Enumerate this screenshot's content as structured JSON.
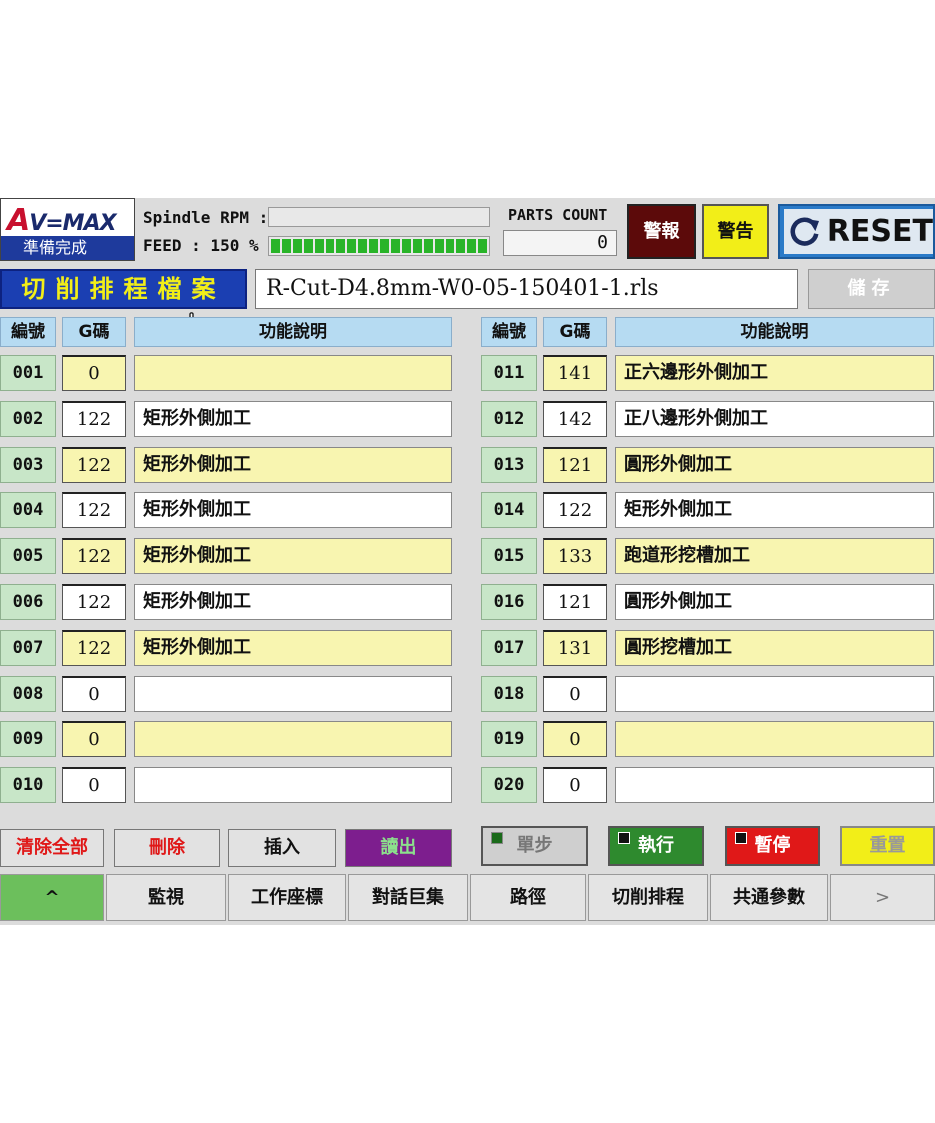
{
  "header": {
    "logo_text": "AVEMAX",
    "status": "準備完成",
    "spindle_label": "Spindle RPM :",
    "feed_label": "FEED :  150 %",
    "feed_level": 1.0,
    "parts_count_label": "PARTS COUNT",
    "parts_count_value": "0",
    "alarm_label": "警報",
    "warning_label": "警告",
    "reset_label": "RESET"
  },
  "program": {
    "title": "切削排程檔案",
    "file_name": "R-Cut-D4.8mm-W0-05-150401-1.rls",
    "save_label": "儲存"
  },
  "table": {
    "col_num": "編號",
    "col_g": "G碼",
    "col_desc": "功能說明",
    "left_rows": [
      {
        "num": "001",
        "g": "0",
        "desc": ""
      },
      {
        "num": "002",
        "g": "122",
        "desc": "矩形外側加工"
      },
      {
        "num": "003",
        "g": "122",
        "desc": "矩形外側加工"
      },
      {
        "num": "004",
        "g": "122",
        "desc": "矩形外側加工"
      },
      {
        "num": "005",
        "g": "122",
        "desc": "矩形外側加工"
      },
      {
        "num": "006",
        "g": "122",
        "desc": "矩形外側加工"
      },
      {
        "num": "007",
        "g": "122",
        "desc": "矩形外側加工"
      },
      {
        "num": "008",
        "g": "0",
        "desc": ""
      },
      {
        "num": "009",
        "g": "0",
        "desc": ""
      },
      {
        "num": "010",
        "g": "0",
        "desc": ""
      }
    ],
    "right_rows": [
      {
        "num": "011",
        "g": "141",
        "desc": "正六邊形外側加工"
      },
      {
        "num": "012",
        "g": "142",
        "desc": "正八邊形外側加工"
      },
      {
        "num": "013",
        "g": "121",
        "desc": "圓形外側加工"
      },
      {
        "num": "014",
        "g": "122",
        "desc": "矩形外側加工"
      },
      {
        "num": "015",
        "g": "133",
        "desc": "跑道形挖槽加工"
      },
      {
        "num": "016",
        "g": "121",
        "desc": "圓形外側加工"
      },
      {
        "num": "017",
        "g": "131",
        "desc": "圓形挖槽加工"
      },
      {
        "num": "018",
        "g": "0",
        "desc": ""
      },
      {
        "num": "019",
        "g": "0",
        "desc": ""
      },
      {
        "num": "020",
        "g": "0",
        "desc": ""
      }
    ]
  },
  "actions": {
    "clear_all": "清除全部",
    "delete": "刪除",
    "insert": "插入",
    "read_out": "讀出",
    "single_step": "單步",
    "execute": "執行",
    "pause": "暫停",
    "reset": "重置"
  },
  "nav": {
    "up": "^",
    "monitor": "監視",
    "work_coord": "工作座標",
    "dialog_macro": "對話巨集",
    "path": "路徑",
    "cut_schedule": "切削排程",
    "common_params": "共通參數",
    "next": ">"
  },
  "colors": {
    "row_yellow": "#f8f5b0",
    "row_white": "#ffffff",
    "header_blue": "#b6dbf2",
    "title_blue": "#1b3fb2",
    "title_text_yellow": "#f2ee18",
    "alarm_maroon": "#5c0a0a",
    "execute_green": "#2e8a2e",
    "pause_red": "#e01818",
    "readout_purple": "#7d1e8e"
  },
  "icons": {
    "reset": "refresh-icon",
    "cursor": "hand-pointer-icon"
  }
}
